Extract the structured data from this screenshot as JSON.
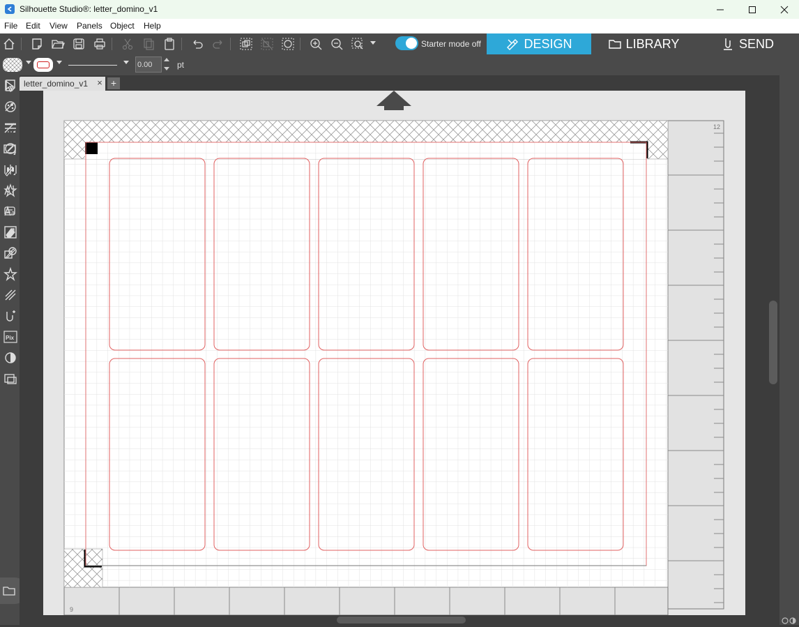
{
  "window": {
    "title": "Silhouette Studio®: letter_domino_v1",
    "minimize_icon": "minimize-icon",
    "maximize_icon": "maximize-icon",
    "close_icon": "close-icon"
  },
  "menu": [
    "File",
    "Edit",
    "View",
    "Panels",
    "Object",
    "Help"
  ],
  "toolbar": {
    "starter_mode_label": "Starter mode off",
    "starter_mode_on": false,
    "accent_color": "#2ea8d8",
    "tabs": [
      {
        "label": "DESIGN",
        "icon": "design-icon",
        "active": true
      },
      {
        "label": "LIBRARY",
        "icon": "folder-icon",
        "active": false
      },
      {
        "label": "SEND",
        "icon": "send-icon",
        "active": false
      }
    ]
  },
  "properties": {
    "line_width": "0.00",
    "unit": "pt",
    "stroke_color": "#d02020"
  },
  "document_tab": {
    "name": "letter_domino_v1",
    "close": "×",
    "new_tab": "+"
  },
  "canvas": {
    "cut_line_color": "#e06060",
    "layout": {
      "columns": 5,
      "rows": 2
    },
    "ruler": {
      "right_top_label": "12",
      "bottom_left_label": "9"
    }
  }
}
